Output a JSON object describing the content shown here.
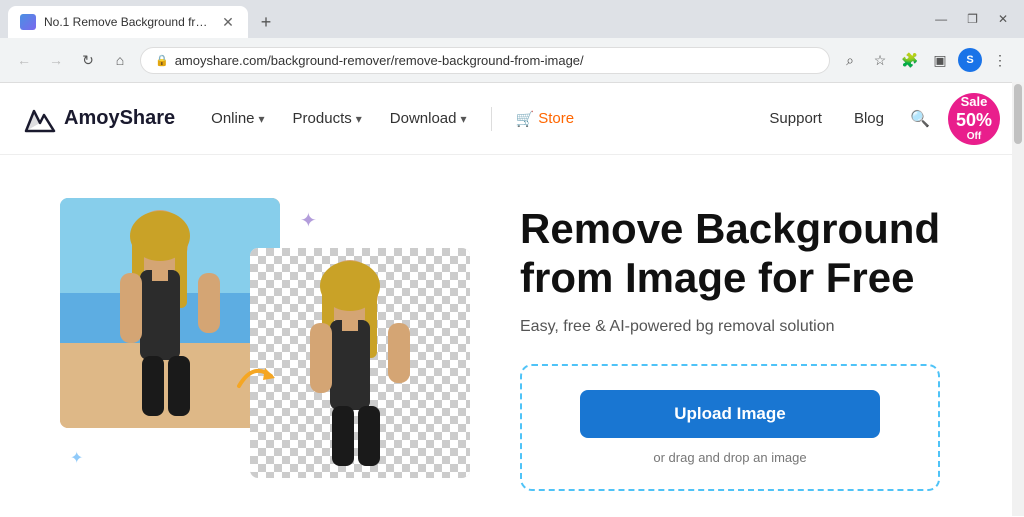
{
  "browser": {
    "tab_title": "No.1 Remove Background from...",
    "url": "amoyshare.com/background-remover/remove-background-from-image/",
    "new_tab_label": "+",
    "window_controls": {
      "minimize": "—",
      "maximize": "❐",
      "close": "✕"
    }
  },
  "nav": {
    "logo_text": "AmoyShare",
    "items": [
      {
        "label": "Online",
        "has_dropdown": true
      },
      {
        "label": "Products",
        "has_dropdown": true
      },
      {
        "label": "Download",
        "has_dropdown": true
      }
    ],
    "store_label": "Store",
    "support_label": "Support",
    "blog_label": "Blog",
    "sale_badge": {
      "sale": "Sale",
      "percent": "50%",
      "off": "Off"
    }
  },
  "hero": {
    "title": "Remove Background\nfrom Image for Free",
    "subtitle": "Easy, free & AI-powered bg removal solution",
    "upload_btn": "Upload Image",
    "drag_hint": "or drag and drop an image"
  },
  "icons": {
    "back": "←",
    "forward": "→",
    "refresh": "↻",
    "home": "⌂",
    "lock": "🔒",
    "search": "⌕",
    "bookmark": "☆",
    "extension": "⬡",
    "sidebar": "▣",
    "profile": "S",
    "menu": "⋮",
    "store_cart": "🛒",
    "arrow": "↪",
    "sparkle": "✦"
  }
}
